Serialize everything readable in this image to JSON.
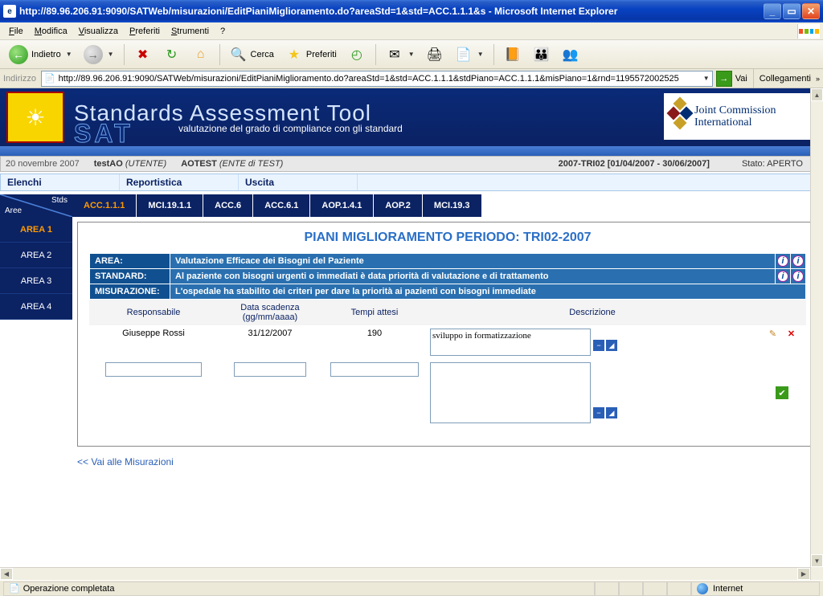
{
  "window": {
    "title": "http://89.96.206.91:9090/SATWeb/misurazioni/EditPianiMiglioramento.do?areaStd=1&std=ACC.1.1.1&s - Microsoft Internet Explorer"
  },
  "menu": {
    "file": "File",
    "edit": "Modifica",
    "view": "Visualizza",
    "favorites": "Preferiti",
    "tools": "Strumenti",
    "help": "?"
  },
  "toolbar": {
    "back": "Indietro",
    "search": "Cerca",
    "favorites": "Preferiti"
  },
  "address": {
    "label": "Indirizzo",
    "url": "http://89.96.206.91:9090/SATWeb/misurazioni/EditPianiMiglioramento.do?areaStd=1&std=ACC.1.1.1&stdPiano=ACC.1.1.1&misPiano=1&rnd=1195572002525",
    "go": "Vai",
    "links": "Collegamenti"
  },
  "app": {
    "title": "Standards Assessment Tool",
    "subtitle": "valutazione del grado di compliance con gli standard",
    "acronym": "SAT",
    "jci_line1": "Joint Commission",
    "jci_line2": "International"
  },
  "info": {
    "date": "20 novembre 2007",
    "user_code": "testAO",
    "user_role": "(UTENTE)",
    "org_code": "AOTEST",
    "org_role": "(ENTE di TEST)",
    "period": "2007-TRI02 [01/04/2007 - 30/06/2007]",
    "state_label": "Stato:",
    "state_value": "APERTO"
  },
  "nav": {
    "elenchi": "Elenchi",
    "reportistica": "Reportistica",
    "uscita": "Uscita"
  },
  "areas_header": {
    "stds": "Stds",
    "aree": "Aree"
  },
  "areas": [
    "AREA 1",
    "AREA 2",
    "AREA 3",
    "AREA 4"
  ],
  "std_tabs": [
    "ACC.1.1.1",
    "MCI.19.1.1",
    "ACC.6",
    "ACC.6.1",
    "AOP.1.4.1",
    "AOP.2",
    "MCI.19.3"
  ],
  "panel": {
    "title": "PIANI MIGLIORAMENTO PERIODO: TRI02-2007",
    "rows": {
      "area_label": "AREA:",
      "area_value": "Valutazione Efficace dei Bisogni del Paziente",
      "standard_label": "STANDARD:",
      "standard_value": "Al paziente con bisogni urgenti o immediati è data priorità di valutazione e di trattamento",
      "misur_label": "MISURAZIONE:",
      "misur_value": "L'ospedale ha stabilito dei criteri per dare la priorità ai pazienti con bisogni immediate"
    },
    "columns": {
      "responsabile": "Responsabile",
      "scadenza": "Data scadenza",
      "scadenza_fmt": "(gg/mm/aaaa)",
      "tempi": "Tempi attesi",
      "descrizione": "Descrizione"
    },
    "row1": {
      "responsabile": "Giuseppe Rossi",
      "scadenza": "31/12/2007",
      "tempi": "190",
      "descrizione": "sviluppo in formatizzazione"
    },
    "backlink": "<< Vai alle Misurazioni"
  },
  "status": {
    "text": "Operazione completata",
    "zone": "Internet"
  }
}
